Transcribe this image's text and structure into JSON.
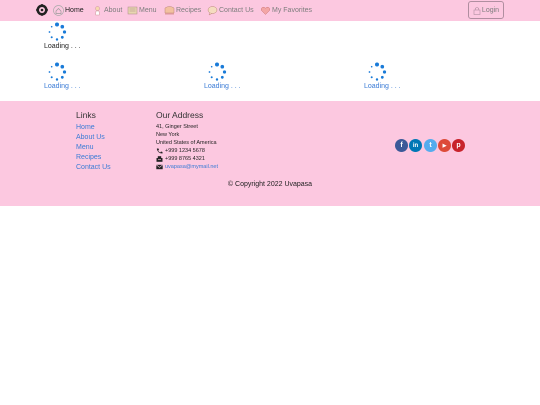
{
  "nav": {
    "items": [
      {
        "label": "Home",
        "icon": "home-icon",
        "active": true
      },
      {
        "label": "About",
        "icon": "chef-icon"
      },
      {
        "label": "Menu",
        "icon": "menu-board-icon"
      },
      {
        "label": "Recipes",
        "icon": "recipe-book-icon"
      },
      {
        "label": "Contact Us",
        "icon": "chat-icon"
      },
      {
        "label": "My Favorites",
        "icon": "heart-icon"
      }
    ],
    "login_label": "Login"
  },
  "loading": {
    "primary": "Loading . . .",
    "row": [
      "Loading . . .",
      "Loading . . .",
      "Loading . . ."
    ]
  },
  "footer": {
    "links_heading": "Links",
    "links": [
      "Home",
      "About Us",
      "Menu",
      "Recipes",
      "Contact Us"
    ],
    "address_heading": "Our Address",
    "address_lines": [
      "41, Ginger Street",
      "New York",
      "United States of America"
    ],
    "phone": "+999 1234 5678",
    "fax": "+999 8765 4321",
    "email": "uvapasa@mymail.net",
    "social": [
      {
        "name": "facebook-icon",
        "glyph": "f",
        "color": "#3b5998"
      },
      {
        "name": "linkedin-icon",
        "glyph": "in",
        "color": "#0077b5"
      },
      {
        "name": "twitter-icon",
        "glyph": "t",
        "color": "#55acee"
      },
      {
        "name": "youtube-icon",
        "glyph": "▶",
        "color": "#dd4b39"
      },
      {
        "name": "pinterest-icon",
        "glyph": "p",
        "color": "#c8232c"
      }
    ],
    "copyright": "© Copyright 2022 Uvapasa"
  },
  "colors": {
    "nav_bg": "#fcc8e0",
    "link": "#3a7bd5",
    "spinner": "#1a7bd8"
  }
}
